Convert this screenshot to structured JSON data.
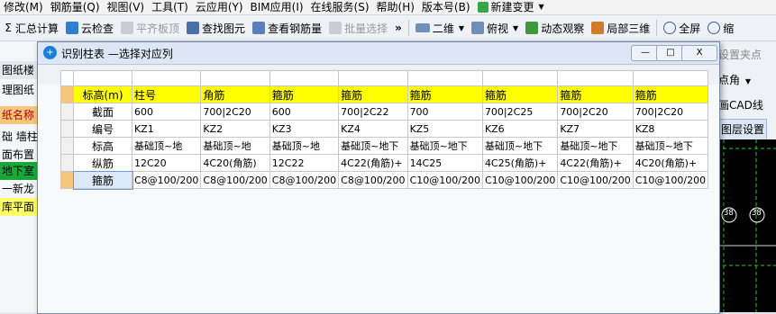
{
  "menubar": {
    "items": [
      "修改(M)",
      "钢筋量(Q)",
      "视图(V)",
      "工具(T)",
      "云应用(Y)",
      "BIM应用(I)",
      "在线服务(S)",
      "帮助(H)",
      "版本号(B)"
    ],
    "new_change": "新建变更"
  },
  "toolbar": {
    "sum": "汇总计算",
    "cloud_check": "云检查",
    "flat_slab": "平齐板顶",
    "find_element": "查找图元",
    "view_rebar": "查看钢筋量",
    "batch_select": "批量选择",
    "more": "»",
    "view_2d": "二维",
    "top_view": "俯视",
    "dynamic_view": "动态观察",
    "local_3d": "局部三维",
    "fullscreen": "全屏",
    "zoom_out": "缩"
  },
  "left_panel": {
    "items": [
      "图纸楼",
      "理图纸",
      "纸名称",
      "础 墙柱",
      "面布置",
      "地下室",
      "一新龙",
      "库平面"
    ]
  },
  "right_panel": {
    "set_point": "设置夹点",
    "point_angle": "点角",
    "cad_line": "画CAD线",
    "layer_settings": "图层设置",
    "cad_marks": [
      "38",
      "38"
    ]
  },
  "dialog": {
    "title": "识别柱表 —选择对应列",
    "minimize": "—",
    "maximize": "□",
    "close": "X"
  },
  "table": {
    "header": {
      "label": "标高(m)",
      "columns": [
        "柱号",
        "角筋",
        "箍筋",
        "箍筋",
        "箍筋",
        "箍筋",
        "箍筋",
        "箍筋"
      ]
    },
    "rows": [
      {
        "label": "截面",
        "cells": [
          "600",
          "700|2C20",
          "600",
          "700|2C22",
          "700",
          "700|2C25",
          "700|2C20",
          "700|2C20"
        ]
      },
      {
        "label": "编号",
        "cells": [
          "KZ1",
          "KZ2",
          "KZ3",
          "KZ4",
          "KZ5",
          "KZ6",
          "KZ7",
          "KZ8"
        ]
      },
      {
        "label": "标高",
        "cells": [
          "基础顶~地",
          "基础顶~地",
          "基础顶~地",
          "基础顶~地下",
          "基础顶~地下",
          "基础顶~地下",
          "基础顶~地下",
          "基础顶~地下"
        ]
      },
      {
        "label": "纵筋",
        "cells": [
          "12C20",
          "4C20(角筋)",
          "12C22",
          "4C22(角筋)+",
          "14C25",
          "4C25(角筋)+",
          "4C22(角筋)+",
          "4C20(角筋)+"
        ]
      },
      {
        "label": "箍筋",
        "cells": [
          "C8@100/200",
          "C8@100/200",
          "C8@100/200",
          "C8@100/200",
          "C10@100/200",
          "C10@100/200",
          "C10@100/200",
          "C10@100/200"
        ]
      }
    ]
  },
  "colors": {
    "header_row": "#ffff00",
    "selected_row_header": "#f6c67a",
    "cad_background": "#000000",
    "cad_green": "#1fd21f"
  }
}
